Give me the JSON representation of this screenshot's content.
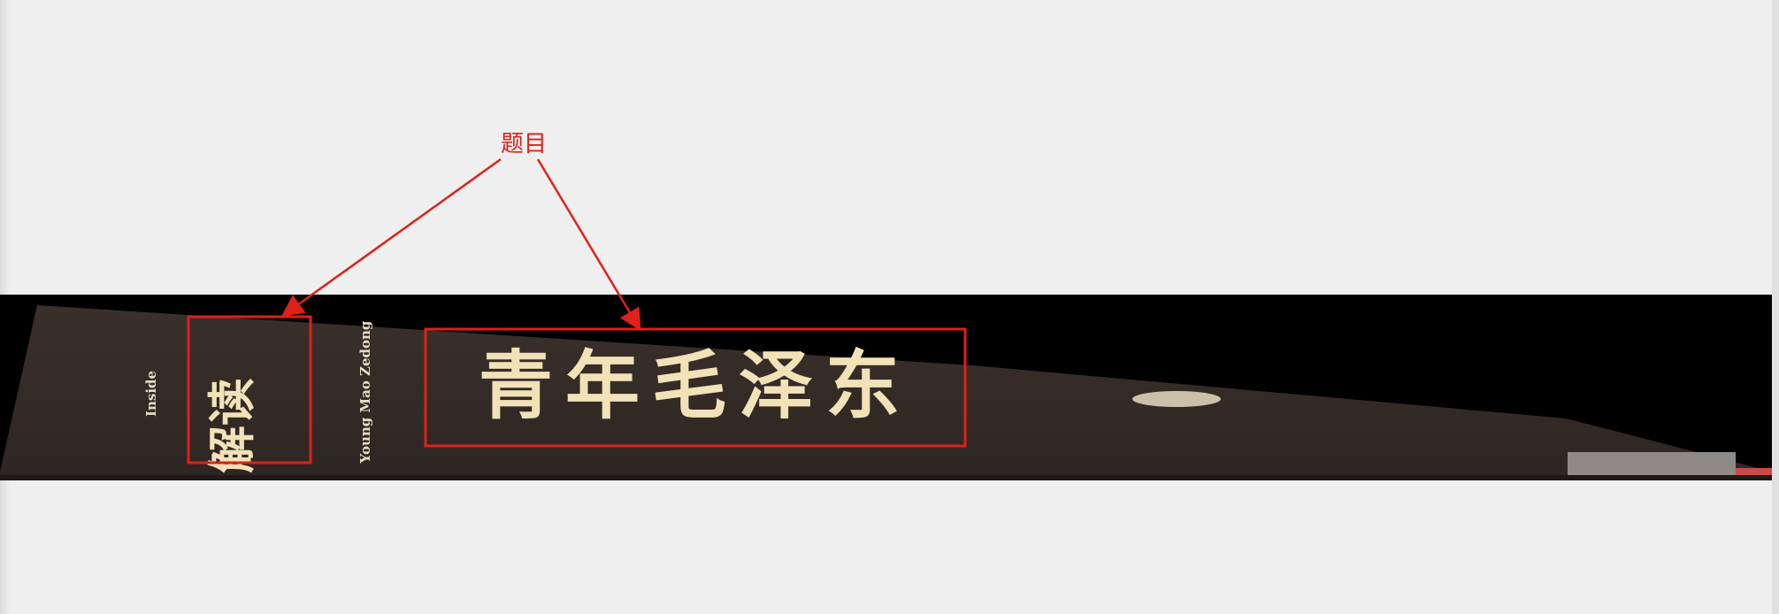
{
  "annotation": {
    "label": "题目",
    "color": "#e0201a"
  },
  "book_spine": {
    "small_left_text": "Inside",
    "left_title": "解读",
    "small_vertical_text": "Young Mao Zedong",
    "main_title": "青年毛泽东"
  }
}
